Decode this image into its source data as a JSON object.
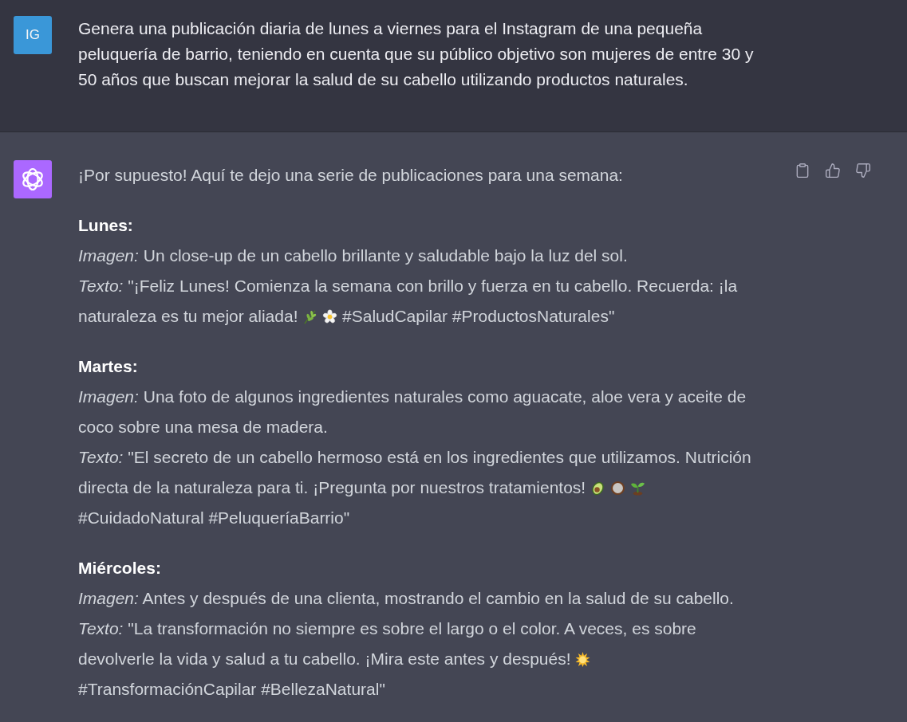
{
  "user_message": {
    "avatar": "IG",
    "text": "Genera una publicación diaria de lunes a viernes para el Instagram de una pequeña peluquería de barrio, teniendo en cuenta que su público objetivo son mujeres de entre 30 y 50 años que buscan mejorar la salud de su cabello utilizando productos naturales."
  },
  "assistant_message": {
    "actions": [
      {
        "kind": "copy"
      },
      {
        "kind": "thumbs_up"
      },
      {
        "kind": "thumbs_down"
      }
    ],
    "intro": "¡Por supuesto! Aquí te dejo una serie de publicaciones para una semana:",
    "posts": [
      {
        "day": "Lunes:",
        "image": "*Imagen:* Un close-up de un cabello brillante y saludable bajo la luz del sol.",
        "text": "*Texto:* \"¡Feliz Lunes! Comienza la semana con brillo y fuerza en tu cabello. Recuerda: ¡la naturaleza es tu mejor aliada!",
        "emojis": [
          {
            "kind": "herb"
          },
          {
            "kind": "flower"
          }
        ],
        "hashtags": "#SaludCapilar #ProductosNaturales\""
      },
      {
        "day": "Martes:",
        "image": "*Imagen:* Una foto de algunos ingredientes naturales como aguacate, aloe vera y aceite de coco sobre una mesa de madera.",
        "text": "*Texto:* \"El secreto de un cabello hermoso está en los ingredientes que utilizamos. Nutrición directa de la naturaleza para ti. ¡Pregunta por nuestros tratamientos!",
        "emojis": [
          {
            "kind": "avocado"
          },
          {
            "kind": "coconut"
          },
          {
            "kind": "seedling"
          }
        ],
        "hashtags": "#CuidadoNatural #PeluqueríaBarrio\""
      },
      {
        "day": "Miércoles:",
        "image": "*Imagen:* Antes y después de una clienta, mostrando el cambio en la salud de su cabello.",
        "text": "*Texto:* \"La transformación no siempre es sobre el largo o el color. A veces, es sobre devolverle la vida y salud a tu cabello. ¡Mira este antes y después!",
        "emojis": [
          {
            "kind": "sun"
          }
        ],
        "hashtags": "#TransformaciónCapilar #BellezaNatural\""
      }
    ]
  }
}
